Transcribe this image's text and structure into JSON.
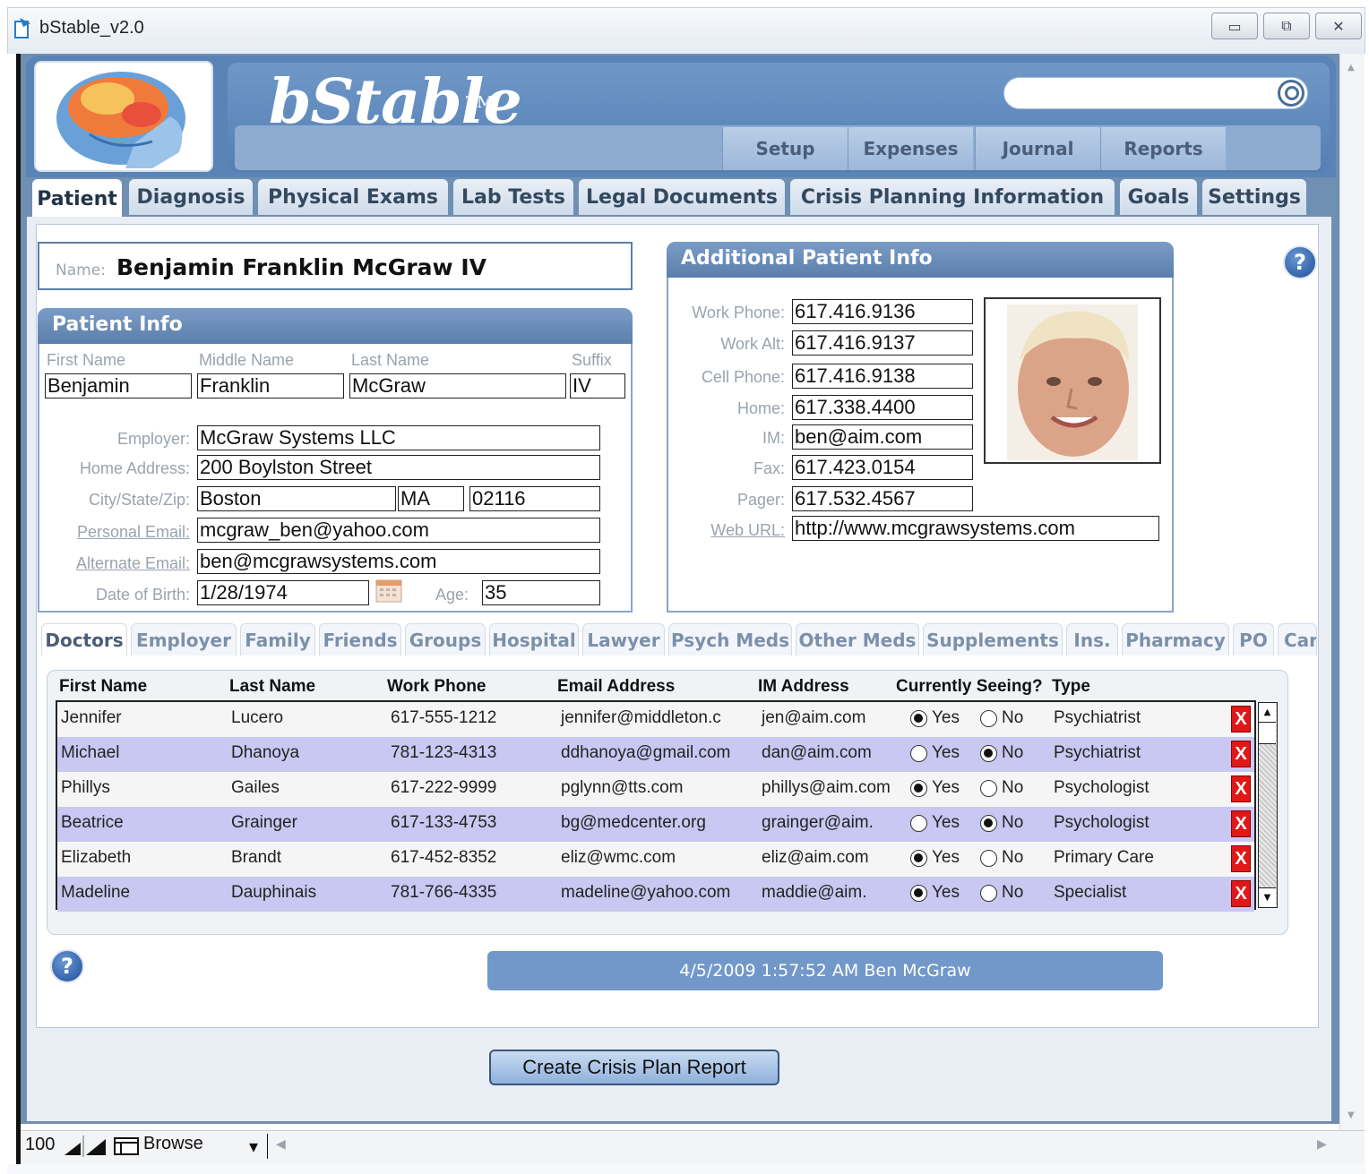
{
  "window": {
    "title": "bStable_v2.0"
  },
  "app": {
    "name": "bStable",
    "trademark": "TM"
  },
  "search": {
    "placeholder": ""
  },
  "top_nav": [
    "Setup",
    "Expenses",
    "Journal",
    "Reports"
  ],
  "main_tabs": [
    "Patient",
    "Diagnosis",
    "Physical Exams",
    "Lab Tests",
    "Legal Documents",
    "Crisis Planning Information",
    "Goals",
    "Settings"
  ],
  "active_tab": "Patient",
  "name_box": {
    "label": "Name:",
    "value": "Benjamin Franklin McGraw IV"
  },
  "patient_info": {
    "title": "Patient Info",
    "headers": {
      "first": "First Name",
      "middle": "Middle Name",
      "last": "Last Name",
      "suffix": "Suffix"
    },
    "first": "Benjamin",
    "middle": "Franklin",
    "last": "McGraw",
    "suffix": "IV",
    "employer_label": "Employer:",
    "employer": "McGraw Systems LLC",
    "address_label": "Home Address:",
    "address": "200 Boylston Street",
    "csz_label": "City/State/Zip:",
    "city": "Boston",
    "state": "MA",
    "zip": "02116",
    "personal_email_label": "Personal Email:",
    "personal_email": "mcgraw_ben@yahoo.com",
    "alt_email_label": "Alternate Email:",
    "alt_email": "ben@mcgrawsystems.com",
    "dob_label": "Date of Birth:",
    "dob": "1/28/1974",
    "age_label": "Age:",
    "age": "35"
  },
  "additional_info": {
    "title": "Additional Patient Info",
    "work_phone_label": "Work Phone:",
    "work_phone": "617.416.9136",
    "work_alt_label": "Work Alt:",
    "work_alt": "617.416.9137",
    "cell_label": "Cell Phone:",
    "cell": "617.416.9138",
    "home_label": "Home:",
    "home": "617.338.4400",
    "im_label": "IM:",
    "im": "ben@aim.com",
    "fax_label": "Fax:",
    "fax": "617.423.0154",
    "pager_label": "Pager:",
    "pager": "617.532.4567",
    "web_label": "Web URL:",
    "web": "http://www.mcgrawsystems.com"
  },
  "sub_tabs": [
    "Doctors",
    "Employer",
    "Family",
    "Friends",
    "Groups",
    "Hospital",
    "Lawyer",
    "Psych Meds",
    "Other Meds",
    "Supplements",
    "Ins.",
    "Pharmacy",
    "PO",
    "Car"
  ],
  "active_sub_tab": "Doctors",
  "doctors": {
    "columns": [
      "First Name",
      "Last Name",
      "Work Phone",
      "Email Address",
      "IM Address",
      "Currently Seeing?",
      "Type"
    ],
    "yes_label": "Yes",
    "no_label": "No",
    "rows": [
      {
        "first": "Jennifer",
        "last": "Lucero",
        "phone": "617-555-1212",
        "email": "jennifer@middleton.c",
        "im": "jen@aim.com",
        "seeing": "Yes",
        "type": "Psychiatrist"
      },
      {
        "first": "Michael",
        "last": "Dhanoya",
        "phone": "781-123-4313",
        "email": "ddhanoya@gmail.com",
        "im": "dan@aim.com",
        "seeing": "No",
        "type": "Psychiatrist"
      },
      {
        "first": "Phillys",
        "last": "Gailes",
        "phone": "617-222-9999",
        "email": "pglynn@tts.com",
        "im": "phillys@aim.com",
        "seeing": "Yes",
        "type": "Psychologist"
      },
      {
        "first": "Beatrice",
        "last": "Grainger",
        "phone": "617-133-4753",
        "email": "bg@medcenter.org",
        "im": "grainger@aim.",
        "seeing": "No",
        "type": "Psychologist"
      },
      {
        "first": "Elizabeth",
        "last": "Brandt",
        "phone": "617-452-8352",
        "email": "eliz@wmc.com",
        "im": "eliz@aim.com",
        "seeing": "Yes",
        "type": "Primary Care"
      },
      {
        "first": "Madeline",
        "last": "Dauphinais",
        "phone": "781-766-4335",
        "email": "madeline@yahoo.com",
        "im": "maddie@aim.",
        "seeing": "Yes",
        "type": "Specialist"
      }
    ]
  },
  "stamp": "4/5/2009 1:57:52 AM Ben McGraw",
  "crisis_button": "Create Crisis Plan Report",
  "status": {
    "zoom": "100",
    "mode": "Browse"
  },
  "colors": {
    "header": "#5b84b6",
    "panel": "#6f8fb3",
    "row_alt": "#c9c8f2",
    "delete": "#e01818"
  }
}
